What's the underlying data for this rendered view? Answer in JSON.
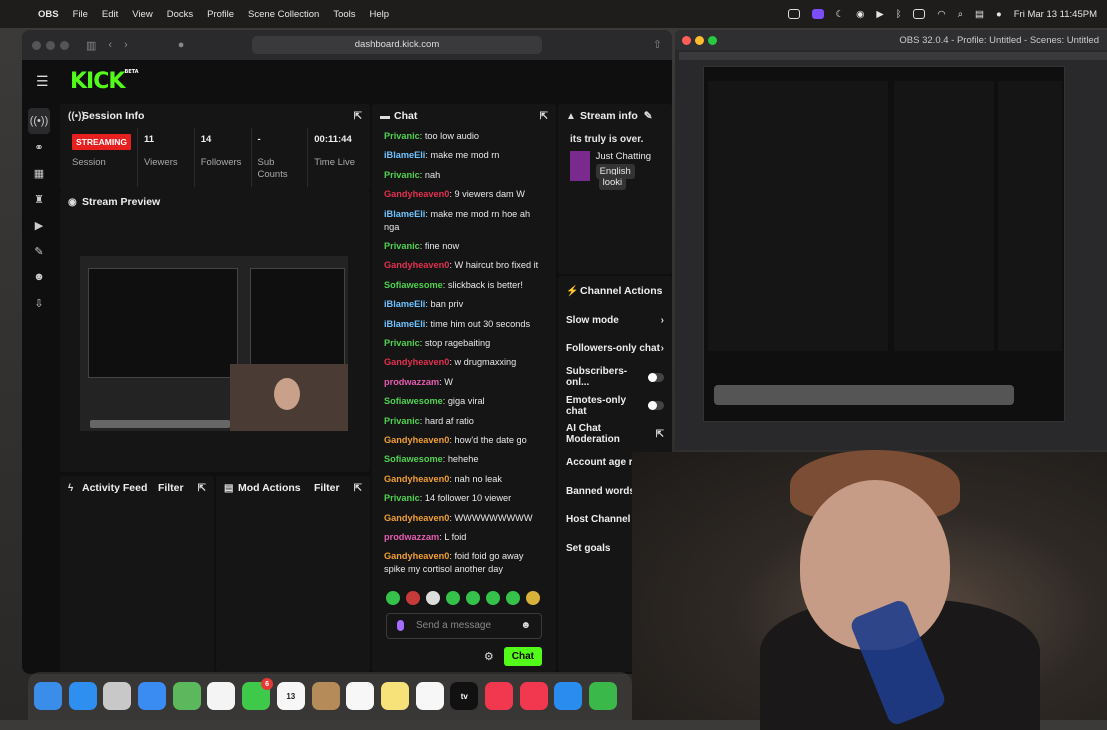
{
  "menubar": {
    "app": "OBS",
    "items": [
      "File",
      "Edit",
      "View",
      "Docks",
      "Profile",
      "Scene Collection",
      "Tools",
      "Help"
    ],
    "clock": "Fri Mar 13  11:45PM"
  },
  "safari": {
    "url": "dashboard.kick.com"
  },
  "kick": {
    "logo": "KICK",
    "beta": "BETA"
  },
  "session": {
    "title": "Session Info",
    "status": "STREAMING",
    "status_label": "Session",
    "stats": [
      {
        "value": "11",
        "label": "Viewers"
      },
      {
        "value": "14",
        "label": "Followers"
      },
      {
        "value": "-",
        "label": "Sub Counts"
      },
      {
        "value": "00:11:44",
        "label": "Time Live"
      }
    ]
  },
  "preview": {
    "title": "Stream Preview"
  },
  "activity": {
    "title": "Activity Feed",
    "filter": "Filter"
  },
  "mod": {
    "title": "Mod Actions",
    "filter": "Filter"
  },
  "chat": {
    "title": "Chat",
    "messages": [
      {
        "user": "Privanic",
        "color": "#4fd14f",
        "text": "too low audio"
      },
      {
        "user": "iBlameEli",
        "color": "#6ec3ff",
        "text": "make me mod rn"
      },
      {
        "user": "Privanic",
        "color": "#4fd14f",
        "text": "nah"
      },
      {
        "user": "Gandyheaven0",
        "color": "#e2314f",
        "text": "9 viewers dam W"
      },
      {
        "user": "iBlameEli",
        "color": "#6ec3ff",
        "text": "make me mod rn hoe ah nga"
      },
      {
        "user": "Privanic",
        "color": "#4fd14f",
        "text": "fine now"
      },
      {
        "user": "Gandyheaven0",
        "color": "#e2314f",
        "text": "W haircut bro fixed it"
      },
      {
        "user": "Sofiawesome",
        "color": "#4fd14f",
        "text": "slickback is better!"
      },
      {
        "user": "iBlameEli",
        "color": "#6ec3ff",
        "text": "ban priv"
      },
      {
        "user": "iBlameEli",
        "color": "#6ec3ff",
        "text": "time him out 30 seconds"
      },
      {
        "user": "Privanic",
        "color": "#4fd14f",
        "text": "stop ragebaiting"
      },
      {
        "user": "Gandyheaven0",
        "color": "#e2314f",
        "text": "w drugmaxxing"
      },
      {
        "user": "prodwazzam",
        "color": "#e55cb0",
        "text": "W"
      },
      {
        "user": "Sofiawesome",
        "color": "#4fd14f",
        "text": "giga viral"
      },
      {
        "user": "Privanic",
        "color": "#4fd14f",
        "text": "hard af ratio"
      },
      {
        "user": "Gandyheaven0",
        "color": "#f0a030",
        "text": "how'd the date go"
      },
      {
        "user": "Sofiawesome",
        "color": "#4fd14f",
        "text": "hehehe"
      },
      {
        "user": "Gandyheaven0",
        "color": "#f0a030",
        "text": "nah no leak"
      },
      {
        "user": "Privanic",
        "color": "#4fd14f",
        "text": "14 follower 10 viewer"
      },
      {
        "user": "Gandyheaven0",
        "color": "#f0a030",
        "text": "WWWWWWWWW"
      },
      {
        "user": "prodwazzam",
        "color": "#e55cb0",
        "text": "L foid"
      },
      {
        "user": "Gandyheaven0",
        "color": "#f0a030",
        "text": "foid foid go away spike my cortisol another day"
      }
    ],
    "placeholder": "Send a message",
    "send": "Chat"
  },
  "stream_info": {
    "title": "Stream info",
    "stream_title": "its truly is over.",
    "category": "Just Chatting",
    "tags": [
      "English",
      "looki"
    ]
  },
  "channel_actions": {
    "title": "Channel Actions",
    "items": [
      {
        "label": "Slow mode",
        "kind": "chevron"
      },
      {
        "label": "Followers-only chat",
        "kind": "chevron"
      },
      {
        "label": "Subscribers-onl...",
        "kind": "toggle"
      },
      {
        "label": "Emotes-only chat",
        "kind": "toggle"
      },
      {
        "label": "AI Chat Moderation",
        "kind": "external"
      },
      {
        "label": "Account age re",
        "kind": "none"
      },
      {
        "label": "Banned words",
        "kind": "none"
      },
      {
        "label": "Host Channel",
        "kind": "none"
      },
      {
        "label": "Set goals",
        "kind": "none"
      }
    ]
  },
  "obs": {
    "title": "OBS 32.0.4 - Profile: Untitled - Scenes: Untitled"
  },
  "dock": {
    "apps": [
      {
        "name": "Finder",
        "color": "#3a8de8"
      },
      {
        "name": "Safari",
        "color": "#2f8ff0"
      },
      {
        "name": "Launchpad",
        "color": "#c8c8c8"
      },
      {
        "name": "Mail",
        "color": "#3b8cf2"
      },
      {
        "name": "Maps",
        "color": "#5cb85c"
      },
      {
        "name": "Photos",
        "color": "#f4f4f4"
      },
      {
        "name": "FaceTime",
        "color": "#3ec94b",
        "badge": "6"
      },
      {
        "name": "Calendar",
        "color": "#f7f7f7",
        "label": "13"
      },
      {
        "name": "Contacts",
        "color": "#b58b5a"
      },
      {
        "name": "Reminders",
        "color": "#f7f7f7"
      },
      {
        "name": "Notes",
        "color": "#f7e27a"
      },
      {
        "name": "Freeform",
        "color": "#f7f7f7"
      },
      {
        "name": "TV",
        "color": "#111111",
        "label": "tv"
      },
      {
        "name": "Music",
        "color": "#f2384f"
      },
      {
        "name": "News",
        "color": "#f2384f"
      },
      {
        "name": "Keynote",
        "color": "#2b8cf0"
      },
      {
        "name": "Numbers",
        "color": "#3ab84a"
      }
    ]
  }
}
